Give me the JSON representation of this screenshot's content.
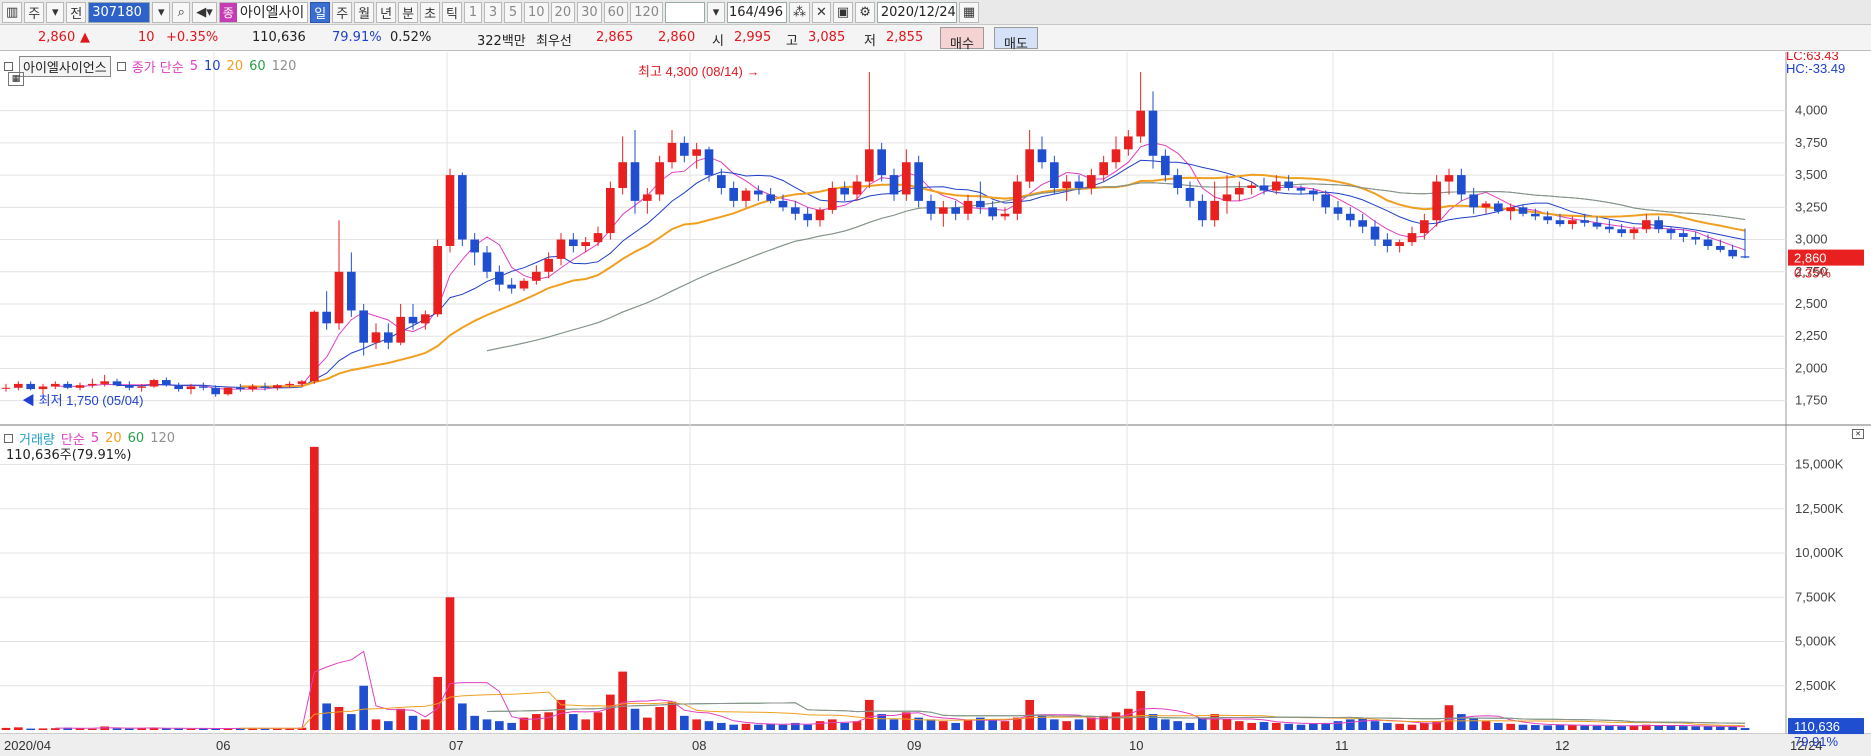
{
  "toolbar": {
    "btn1": "주",
    "btn2": "전",
    "code": "307180",
    "stock_badge": "종",
    "stock_name": "아이엘사이",
    "periods": [
      "일",
      "주",
      "월",
      "년",
      "분",
      "초",
      "틱"
    ],
    "active_period": "일",
    "intervals": [
      "1",
      "3",
      "5",
      "10",
      "20",
      "30",
      "60",
      "120"
    ],
    "count": "164",
    "total": "/496",
    "date": "2020/12/24"
  },
  "info": {
    "price": "2,860",
    "up_arrow": "▲",
    "change": "10",
    "change_pct": "+0.35%",
    "volume": "110,636",
    "vol_ratio": "79.91%",
    "turnover": "0.52%",
    "amount": "322백만",
    "best_label": "최우선",
    "ask": "2,865",
    "bid": "2,860",
    "open_label": "시",
    "open": "2,995",
    "high_label": "고",
    "high": "3,085",
    "low_label": "저",
    "low": "2,855",
    "buy": "매수",
    "sell": "매도"
  },
  "price_panel": {
    "title": "아이엘사이언스",
    "legend_label": "종가 단순",
    "ma_labels": [
      "5",
      "10",
      "20",
      "60",
      "120"
    ],
    "lc": "LC:63.43",
    "hc": "HC:-33.49",
    "high_note": "최고 4,300 (08/14)",
    "low_note": "최저 1,750 (05/04)",
    "current_price": "2,860",
    "current_pct": "0.35%",
    "y_ticks": [
      "4,000",
      "3,750",
      "3,500",
      "3,250",
      "3,000",
      "2,750",
      "2,500",
      "2,250",
      "2,000",
      "1,750"
    ]
  },
  "volume_panel": {
    "title": "거래량",
    "legend_label": "단순",
    "ma_labels": [
      "5",
      "20",
      "60",
      "120"
    ],
    "current_volume_text": "110,636주(79.91%)",
    "current_volume": "110,636",
    "current_pct": "79.91%",
    "y_ticks": [
      "15,000K",
      "12,500K",
      "10,000K",
      "7,500K",
      "5,000K",
      "2,500K"
    ]
  },
  "x_axis": [
    "2020/04",
    "06",
    "07",
    "08",
    "09",
    "10",
    "11",
    "12",
    "12/24"
  ],
  "colors": {
    "up": "#e8201f",
    "down": "#1f4fd0",
    "ma5": "#e040c0",
    "ma10": "#2040c8",
    "ma20": "#f0a020",
    "ma60": "#28a048",
    "ma120": "#909090"
  },
  "chart_data": {
    "type": "candlestick",
    "price_range": [
      1600,
      4300
    ],
    "volume_range": [
      0,
      16500
    ],
    "volume_unit": "K",
    "dates": [
      "2020/04",
      "06",
      "07",
      "08",
      "09",
      "10",
      "11",
      "12",
      "12/24"
    ],
    "ohlc": [
      [
        1850,
        1880,
        1820,
        1850
      ],
      [
        1850,
        1900,
        1830,
        1880
      ],
      [
        1880,
        1900,
        1830,
        1840
      ],
      [
        1840,
        1880,
        1800,
        1860
      ],
      [
        1860,
        1900,
        1840,
        1880
      ],
      [
        1880,
        1900,
        1840,
        1850
      ],
      [
        1850,
        1890,
        1830,
        1870
      ],
      [
        1870,
        1920,
        1850,
        1880
      ],
      [
        1880,
        1950,
        1860,
        1900
      ],
      [
        1900,
        1920,
        1860,
        1870
      ],
      [
        1870,
        1900,
        1830,
        1850
      ],
      [
        1850,
        1880,
        1820,
        1860
      ],
      [
        1860,
        1920,
        1850,
        1910
      ],
      [
        1910,
        1930,
        1860,
        1870
      ],
      [
        1870,
        1890,
        1820,
        1840
      ],
      [
        1840,
        1880,
        1800,
        1860
      ],
      [
        1860,
        1890,
        1830,
        1850
      ],
      [
        1850,
        1870,
        1780,
        1800
      ],
      [
        1800,
        1860,
        1790,
        1850
      ],
      [
        1850,
        1880,
        1820,
        1840
      ],
      [
        1840,
        1880,
        1820,
        1860
      ],
      [
        1860,
        1890,
        1830,
        1850
      ],
      [
        1850,
        1880,
        1830,
        1870
      ],
      [
        1870,
        1900,
        1850,
        1880
      ],
      [
        1880,
        1910,
        1860,
        1900
      ],
      [
        1900,
        2450,
        1880,
        2440
      ],
      [
        2440,
        2600,
        2300,
        2350
      ],
      [
        2350,
        3150,
        2300,
        2750
      ],
      [
        2750,
        2900,
        2400,
        2450
      ],
      [
        2450,
        2500,
        2100,
        2200
      ],
      [
        2200,
        2350,
        2150,
        2280
      ],
      [
        2280,
        2350,
        2150,
        2200
      ],
      [
        2200,
        2500,
        2180,
        2400
      ],
      [
        2400,
        2500,
        2300,
        2350
      ],
      [
        2350,
        2450,
        2300,
        2420
      ],
      [
        2420,
        3000,
        2400,
        2950
      ],
      [
        2950,
        3550,
        2900,
        3500
      ],
      [
        3500,
        3520,
        2950,
        3000
      ],
      [
        3000,
        3050,
        2800,
        2900
      ],
      [
        2900,
        2950,
        2700,
        2750
      ],
      [
        2750,
        2800,
        2600,
        2650
      ],
      [
        2650,
        2700,
        2580,
        2620
      ],
      [
        2620,
        2700,
        2600,
        2680
      ],
      [
        2680,
        2800,
        2650,
        2750
      ],
      [
        2750,
        2900,
        2700,
        2850
      ],
      [
        2850,
        3050,
        2800,
        3000
      ],
      [
        3000,
        3050,
        2900,
        2950
      ],
      [
        2950,
        3020,
        2900,
        2980
      ],
      [
        2980,
        3100,
        2950,
        3050
      ],
      [
        3050,
        3450,
        3000,
        3400
      ],
      [
        3400,
        3800,
        3350,
        3600
      ],
      [
        3600,
        3850,
        3200,
        3300
      ],
      [
        3300,
        3400,
        3200,
        3350
      ],
      [
        3350,
        3650,
        3300,
        3600
      ],
      [
        3600,
        3850,
        3550,
        3750
      ],
      [
        3750,
        3800,
        3600,
        3650
      ],
      [
        3650,
        3750,
        3550,
        3700
      ],
      [
        3700,
        3720,
        3450,
        3500
      ],
      [
        3500,
        3550,
        3350,
        3400
      ],
      [
        3400,
        3450,
        3250,
        3300
      ],
      [
        3300,
        3400,
        3250,
        3380
      ],
      [
        3380,
        3420,
        3300,
        3350
      ],
      [
        3350,
        3400,
        3280,
        3300
      ],
      [
        3300,
        3350,
        3220,
        3250
      ],
      [
        3250,
        3300,
        3150,
        3200
      ],
      [
        3200,
        3250,
        3100,
        3150
      ],
      [
        3150,
        3250,
        3100,
        3230
      ],
      [
        3230,
        3450,
        3200,
        3400
      ],
      [
        3400,
        3450,
        3300,
        3350
      ],
      [
        3350,
        3500,
        3300,
        3450
      ],
      [
        3450,
        4300,
        3400,
        3700
      ],
      [
        3700,
        3750,
        3450,
        3500
      ],
      [
        3500,
        3550,
        3300,
        3350
      ],
      [
        3350,
        3700,
        3300,
        3600
      ],
      [
        3600,
        3650,
        3250,
        3300
      ],
      [
        3300,
        3350,
        3150,
        3200
      ],
      [
        3200,
        3300,
        3100,
        3250
      ],
      [
        3250,
        3300,
        3150,
        3200
      ],
      [
        3200,
        3350,
        3150,
        3300
      ],
      [
        3300,
        3450,
        3200,
        3250
      ],
      [
        3250,
        3300,
        3150,
        3180
      ],
      [
        3180,
        3250,
        3150,
        3200
      ],
      [
        3200,
        3500,
        3150,
        3450
      ],
      [
        3450,
        3850,
        3400,
        3700
      ],
      [
        3700,
        3800,
        3550,
        3600
      ],
      [
        3600,
        3650,
        3350,
        3400
      ],
      [
        3400,
        3500,
        3300,
        3450
      ],
      [
        3450,
        3500,
        3350,
        3400
      ],
      [
        3400,
        3550,
        3350,
        3500
      ],
      [
        3500,
        3650,
        3450,
        3600
      ],
      [
        3600,
        3800,
        3550,
        3700
      ],
      [
        3700,
        3850,
        3650,
        3800
      ],
      [
        3800,
        4300,
        3750,
        4000
      ],
      [
        4000,
        4150,
        3550,
        3650
      ],
      [
        3650,
        3700,
        3450,
        3500
      ],
      [
        3500,
        3550,
        3350,
        3400
      ],
      [
        3400,
        3450,
        3250,
        3300
      ],
      [
        3300,
        3350,
        3100,
        3150
      ],
      [
        3150,
        3450,
        3100,
        3300
      ],
      [
        3300,
        3500,
        3200,
        3350
      ],
      [
        3350,
        3450,
        3300,
        3400
      ],
      [
        3400,
        3450,
        3350,
        3420
      ],
      [
        3420,
        3480,
        3350,
        3380
      ],
      [
        3380,
        3500,
        3350,
        3450
      ],
      [
        3450,
        3500,
        3380,
        3400
      ],
      [
        3400,
        3420,
        3350,
        3380
      ],
      [
        3380,
        3400,
        3300,
        3350
      ],
      [
        3350,
        3380,
        3200,
        3250
      ],
      [
        3250,
        3300,
        3150,
        3200
      ],
      [
        3200,
        3250,
        3100,
        3150
      ],
      [
        3150,
        3200,
        3050,
        3100
      ],
      [
        3100,
        3150,
        2950,
        3000
      ],
      [
        3000,
        3050,
        2900,
        2950
      ],
      [
        2950,
        3000,
        2900,
        2980
      ],
      [
        2980,
        3100,
        2950,
        3050
      ],
      [
        3050,
        3200,
        3000,
        3150
      ],
      [
        3150,
        3500,
        3100,
        3450
      ],
      [
        3450,
        3550,
        3350,
        3500
      ],
      [
        3500,
        3550,
        3300,
        3350
      ],
      [
        3350,
        3400,
        3200,
        3250
      ],
      [
        3250,
        3300,
        3200,
        3280
      ],
      [
        3280,
        3300,
        3200,
        3220
      ],
      [
        3220,
        3280,
        3150,
        3250
      ],
      [
        3250,
        3270,
        3180,
        3200
      ],
      [
        3200,
        3240,
        3150,
        3180
      ],
      [
        3180,
        3220,
        3120,
        3150
      ],
      [
        3150,
        3200,
        3100,
        3120
      ],
      [
        3120,
        3180,
        3080,
        3150
      ],
      [
        3150,
        3200,
        3100,
        3130
      ],
      [
        3130,
        3180,
        3080,
        3100
      ],
      [
        3100,
        3150,
        3050,
        3080
      ],
      [
        3080,
        3120,
        3020,
        3050
      ],
      [
        3050,
        3100,
        3000,
        3080
      ],
      [
        3080,
        3200,
        3050,
        3150
      ],
      [
        3150,
        3180,
        3050,
        3080
      ],
      [
        3080,
        3100,
        3000,
        3050
      ],
      [
        3050,
        3080,
        2980,
        3020
      ],
      [
        3020,
        3060,
        2960,
        3000
      ],
      [
        3000,
        3040,
        2920,
        2950
      ],
      [
        2950,
        3000,
        2900,
        2920
      ],
      [
        2920,
        2960,
        2850,
        2870
      ],
      [
        2870,
        3085,
        2855,
        2860
      ]
    ],
    "volume": [
      120,
      150,
      80,
      90,
      100,
      130,
      110,
      70,
      200,
      90,
      80,
      100,
      120,
      90,
      80,
      70,
      90,
      80,
      100,
      110,
      90,
      80,
      70,
      90,
      130,
      16000,
      1500,
      1300,
      900,
      2500,
      600,
      500,
      1200,
      800,
      600,
      3000,
      7500,
      1500,
      800,
      600,
      500,
      400,
      700,
      900,
      1000,
      1700,
      900,
      600,
      1000,
      2000,
      3300,
      1200,
      700,
      1300,
      1600,
      800,
      600,
      500,
      400,
      300,
      350,
      300,
      350,
      300,
      400,
      300,
      500,
      600,
      400,
      500,
      1700,
      900,
      600,
      1000,
      700,
      600,
      500,
      400,
      600,
      700,
      600,
      500,
      700,
      1700,
      800,
      600,
      500,
      600,
      700,
      800,
      1000,
      1200,
      2200,
      900,
      600,
      500,
      400,
      700,
      900,
      600,
      500,
      400,
      450,
      400,
      350,
      300,
      350,
      400,
      500,
      600,
      700,
      500,
      400,
      350,
      300,
      400,
      500,
      1400,
      900,
      700,
      500,
      400,
      350,
      300,
      280,
      260,
      300,
      280,
      250,
      240,
      230,
      220,
      260,
      300,
      250,
      230,
      220,
      210,
      200,
      190,
      180,
      110
    ],
    "series": [
      {
        "name": "5"
      },
      {
        "name": "10"
      },
      {
        "name": "20"
      },
      {
        "name": "60"
      },
      {
        "name": "120"
      }
    ]
  }
}
